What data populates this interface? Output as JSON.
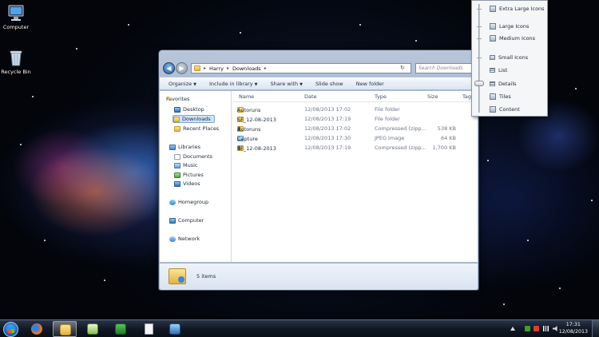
{
  "desktop": {
    "icons": [
      {
        "label": "Computer"
      },
      {
        "label": "Recycle Bin"
      }
    ]
  },
  "explorer": {
    "path": [
      "Harry",
      "Downloads"
    ],
    "search_placeholder": "Search Downloads",
    "toolbar": {
      "organize": "Organize",
      "include_in_library": "Include in library",
      "share_with": "Share with",
      "slide_show": "Slide show",
      "new_folder": "New folder"
    },
    "nav": {
      "favorites": "Favorites",
      "desktop": "Desktop",
      "downloads": "Downloads",
      "recent_places": "Recent Places",
      "libraries": "Libraries",
      "documents": "Documents",
      "music": "Music",
      "pictures": "Pictures",
      "videos": "Videos",
      "homegroup": "Homegroup",
      "computer": "Computer",
      "network": "Network"
    },
    "columns": {
      "name": "Name",
      "date": "Date",
      "type": "Type",
      "size": "Size",
      "tags": "Tags"
    },
    "files": [
      {
        "name": "Autoruns",
        "date": "12/08/2013 17:02",
        "type": "File folder",
        "size": "",
        "icon": "folder-icon"
      },
      {
        "name": "SF_12-08-2013",
        "date": "12/08/2013 17:19",
        "type": "File folder",
        "size": "",
        "icon": "folder-icon"
      },
      {
        "name": "Autoruns",
        "date": "12/08/2013 17:02",
        "type": "Compressed (zipp...",
        "size": "538 KB",
        "icon": "zip-icon"
      },
      {
        "name": "Capture",
        "date": "12/08/2013 17:30",
        "type": "JPEG image",
        "size": "64 KB",
        "icon": "jpeg-icon"
      },
      {
        "name": "SF_12-08-2013",
        "date": "12/08/2013 17:19",
        "type": "Compressed (zipp...",
        "size": "1,700 KB",
        "icon": "zip-icon"
      }
    ],
    "status": {
      "item_count": "5 items"
    }
  },
  "view_menu": {
    "items": [
      {
        "label": "Extra Large Icons"
      },
      {
        "label": "Large Icons"
      },
      {
        "label": "Medium Icons"
      },
      {
        "label": "Small Icons"
      },
      {
        "label": "List"
      },
      {
        "label": "Details"
      },
      {
        "label": "Tiles"
      },
      {
        "label": "Content"
      }
    ],
    "selected": "Details"
  },
  "taskbar": {
    "clock_time": "17:31",
    "clock_date": "12/08/2013",
    "pinned": [
      "firefox-icon",
      "explorer-icon",
      "notepad-plus-icon",
      "ccleaner-icon",
      "document-icon",
      "remote-desktop-icon"
    ]
  }
}
